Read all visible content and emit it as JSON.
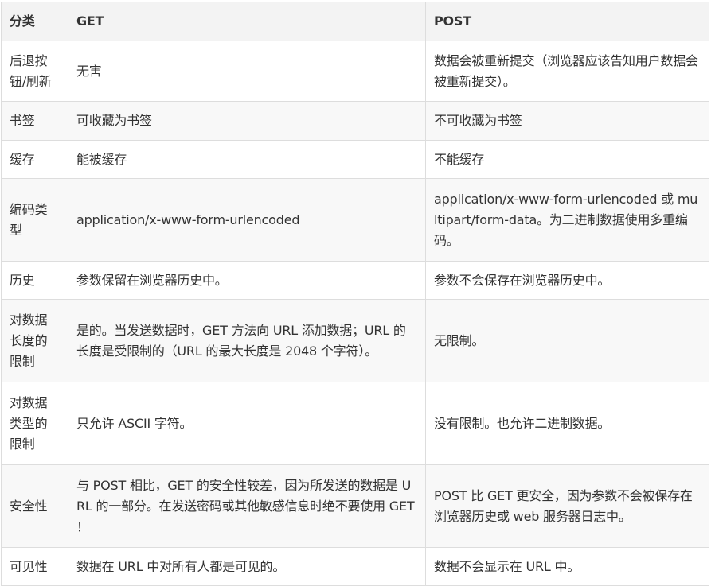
{
  "table": {
    "headers": [
      "分类",
      "GET",
      "POST"
    ],
    "rows": [
      {
        "category": "后退按钮/刷新",
        "get": "无害",
        "post": "数据会被重新提交（浏览器应该告知用户数据会被重新提交）。"
      },
      {
        "category": "书签",
        "get": "可收藏为书签",
        "post": "不可收藏为书签"
      },
      {
        "category": "缓存",
        "get": "能被缓存",
        "post": "不能缓存"
      },
      {
        "category": "编码类型",
        "get": "application/x-www-form-urlencoded",
        "post": "application/x-www-form-urlencoded 或 multipart/form-data。为二进制数据使用多重编码。"
      },
      {
        "category": "历史",
        "get": "参数保留在浏览器历史中。",
        "post": "参数不会保存在浏览器历史中。"
      },
      {
        "category": "对数据长度的限制",
        "get": "是的。当发送数据时，GET 方法向 URL 添加数据；URL 的长度是受限制的（URL 的最大长度是 2048 个字符）。",
        "post": "无限制。"
      },
      {
        "category": "对数据类型的限制",
        "get": "只允许 ASCII 字符。",
        "post": "没有限制。也允许二进制数据。"
      },
      {
        "category": "安全性",
        "get": "与 POST 相比，GET 的安全性较差，因为所发送的数据是 URL 的一部分。在发送密码或其他敏感信息时绝不要使用 GET ！",
        "post": "POST 比 GET 更安全，因为参数不会被保存在浏览器历史或 web 服务器日志中。"
      },
      {
        "category": "可见性",
        "get": "数据在 URL 中对所有人都是可见的。",
        "post": "数据不会显示在 URL 中。"
      }
    ]
  }
}
